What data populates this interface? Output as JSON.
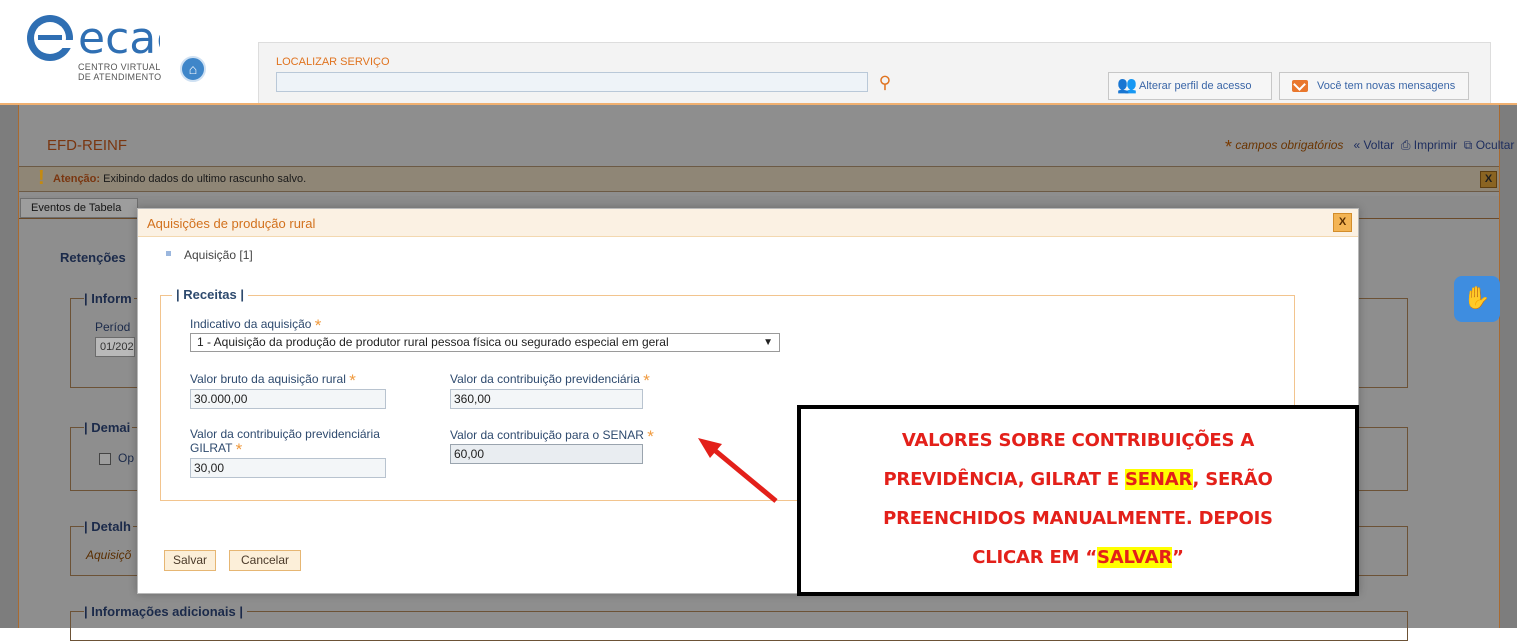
{
  "header": {
    "logo_text": "ecac",
    "logo_sub1": "CENTRO VIRTUAL",
    "logo_sub2": "DE ATENDIMENTO",
    "search_label": "LOCALIZAR SERVIÇO",
    "search_value": "",
    "profile_button": "Alterar perfil de acesso",
    "messages_button": "Você tem novas mensagens"
  },
  "page": {
    "title": "EFD-REINF",
    "required_note": "campos obrigatórios",
    "back": "Voltar",
    "print": "Imprimir",
    "hide_all": "Ocultar todos",
    "alert_label": "Atenção:",
    "alert_text": "Exibindo dados do ultimo rascunho salvo.",
    "alert_close": "X",
    "tab_first": "Eventos de Tabela",
    "section_retencoes": "Retenções",
    "legend_inform": "| Inform",
    "periodo_label": "Períod",
    "periodo_value": "01/202",
    "legend_demais": "| Demai",
    "checkbox_label": "Op",
    "legend_detalh": "| Detalh",
    "detalh_text": "Aquisiçõ",
    "legend_adicionais": "| Informações adicionais |"
  },
  "modal": {
    "title": "Aquisições de produção rural",
    "close": "X",
    "acquisition_item": "Aquisição [1]",
    "legend": "| Receitas |",
    "indicativo_label": "Indicativo da aquisição",
    "indicativo_value": "1 - Aquisição da produção de produtor rural pessoa física ou segurado especial em geral",
    "valor_bruto_label": "Valor bruto da aquisição rural",
    "valor_bruto_value": "30.000,00",
    "contrib_prev_label": "Valor da contribuição previdenciária",
    "contrib_prev_value": "360,00",
    "gilrat_label_1": "Valor da contribuição previdenciária",
    "gilrat_label_2": "GILRAT",
    "gilrat_value": "30,00",
    "senar_label": "Valor da contribuição para o SENAR",
    "senar_value": "60,00",
    "save_button": "Salvar",
    "cancel_button": "Cancelar",
    "required_mark": "*"
  },
  "annotation": {
    "line1": "VALORES SOBRE CONTRIBUIÇÕES A",
    "line2_a": "PREVIDÊNCIA, GILRAT E ",
    "line2_hl": "SENAR",
    "line2_b": ", SERÃO",
    "line3": "PREENCHIDOS MANUALMENTE. DEPOIS",
    "line4_a": "CLICAR EM “",
    "line4_hl": "SALVAR",
    "line4_b": "”"
  },
  "colors": {
    "accent_orange": "#e0731f",
    "annotation_red": "#e3201a",
    "highlight": "#ffff00",
    "logo_blue": "#2f6fb3"
  },
  "icons": [
    "home-icon",
    "search-icon",
    "profile-icon",
    "mail-icon",
    "back-icon",
    "print-icon",
    "hide-icon",
    "alert-icon",
    "sign-language-icon",
    "arrow-icon"
  ]
}
